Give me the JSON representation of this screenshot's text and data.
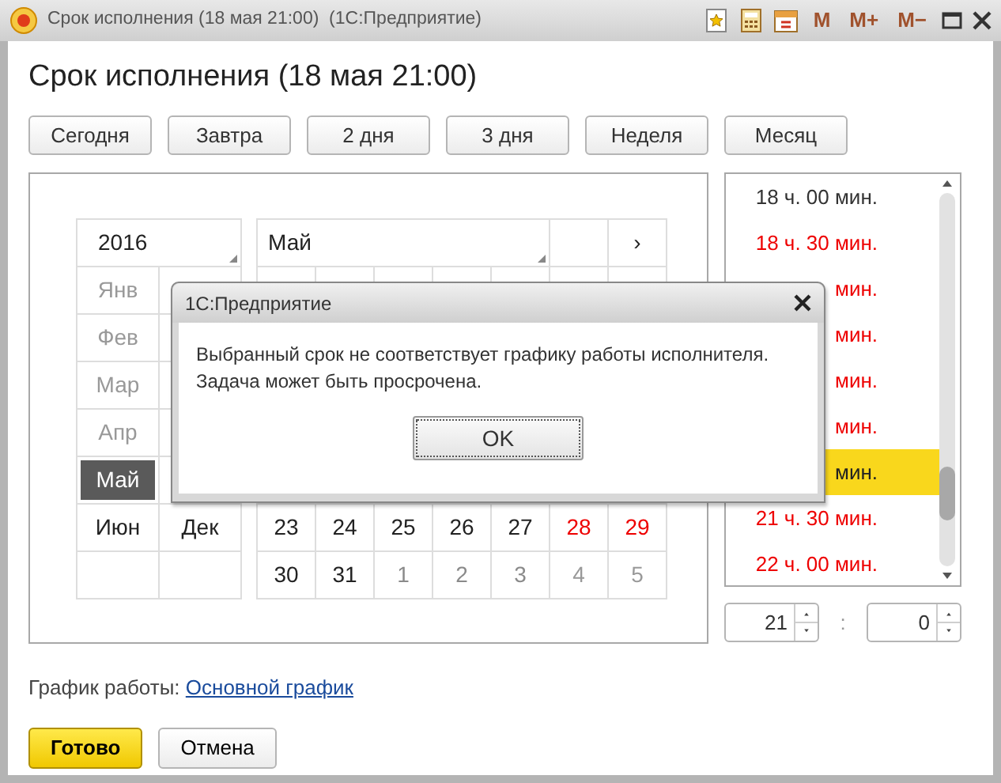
{
  "window": {
    "title": "Срок исполнения (18 мая 21:00)  (1С:Предприятие)",
    "memory_buttons": [
      "M",
      "M+",
      "M−"
    ]
  },
  "heading": "Срок исполнения (18 мая 21:00)",
  "quick_buttons": [
    "Сегодня",
    "Завтра",
    "2 дня",
    "3 дня",
    "Неделя",
    "Месяц"
  ],
  "calendar": {
    "year": "2016",
    "month": "Май",
    "next": "›",
    "month_rows": [
      [
        {
          "label": "Янв",
          "muted": true,
          "selected": false
        }
      ],
      [
        {
          "label": "Фев",
          "muted": true,
          "selected": false
        }
      ],
      [
        {
          "label": "Мар",
          "muted": true,
          "selected": false
        }
      ],
      [
        {
          "label": "Апр",
          "muted": true,
          "selected": false
        }
      ],
      [
        {
          "label": "Май",
          "muted": false,
          "selected": true
        }
      ],
      [
        {
          "label": "Июн",
          "muted": false,
          "selected": false
        },
        {
          "label": "Дек",
          "muted": false,
          "selected": false
        }
      ]
    ],
    "day_rows": [
      [
        {
          "label": "23",
          "weekend": false,
          "muted": false
        },
        {
          "label": "24",
          "weekend": false,
          "muted": false
        },
        {
          "label": "25",
          "weekend": false,
          "muted": false
        },
        {
          "label": "26",
          "weekend": false,
          "muted": false
        },
        {
          "label": "27",
          "weekend": false,
          "muted": false
        },
        {
          "label": "28",
          "weekend": true,
          "muted": false
        },
        {
          "label": "29",
          "weekend": true,
          "muted": false
        }
      ],
      [
        {
          "label": "30",
          "weekend": false,
          "muted": false
        },
        {
          "label": "31",
          "weekend": false,
          "muted": false
        },
        {
          "label": "1",
          "weekend": false,
          "muted": true
        },
        {
          "label": "2",
          "weekend": false,
          "muted": true
        },
        {
          "label": "3",
          "weekend": false,
          "muted": true
        },
        {
          "label": "4",
          "weekend": true,
          "muted": true
        },
        {
          "label": "5",
          "weekend": true,
          "muted": true
        }
      ]
    ]
  },
  "times": [
    {
      "label": "18 ч. 00 мин.",
      "overdue": false,
      "selected": false
    },
    {
      "label": "18 ч. 30 мин.",
      "overdue": true,
      "selected": false
    },
    {
      "label": "мин.",
      "overdue": true,
      "selected": false
    },
    {
      "label": "мин.",
      "overdue": true,
      "selected": false
    },
    {
      "label": "мин.",
      "overdue": true,
      "selected": false
    },
    {
      "label": "мин.",
      "overdue": true,
      "selected": false
    },
    {
      "label": "мин.",
      "selected": true
    },
    {
      "label": "21 ч. 30 мин.",
      "overdue": true,
      "selected": false
    },
    {
      "label": "22 ч. 00 мин.",
      "overdue": true,
      "selected": false
    }
  ],
  "hours": "21",
  "minutes": "0",
  "separator": ":",
  "schedule": {
    "label": "График работы:",
    "link": "Основной график"
  },
  "buttons": [
    {
      "label": "Готово",
      "default": true
    },
    {
      "label": "Отмена",
      "default": false
    }
  ],
  "dialog": {
    "title": "1С:Предприятие",
    "message": "Выбранный срок не соответствует графику работы исполнителя. Задача может быть просрочена.",
    "button": "OK"
  }
}
